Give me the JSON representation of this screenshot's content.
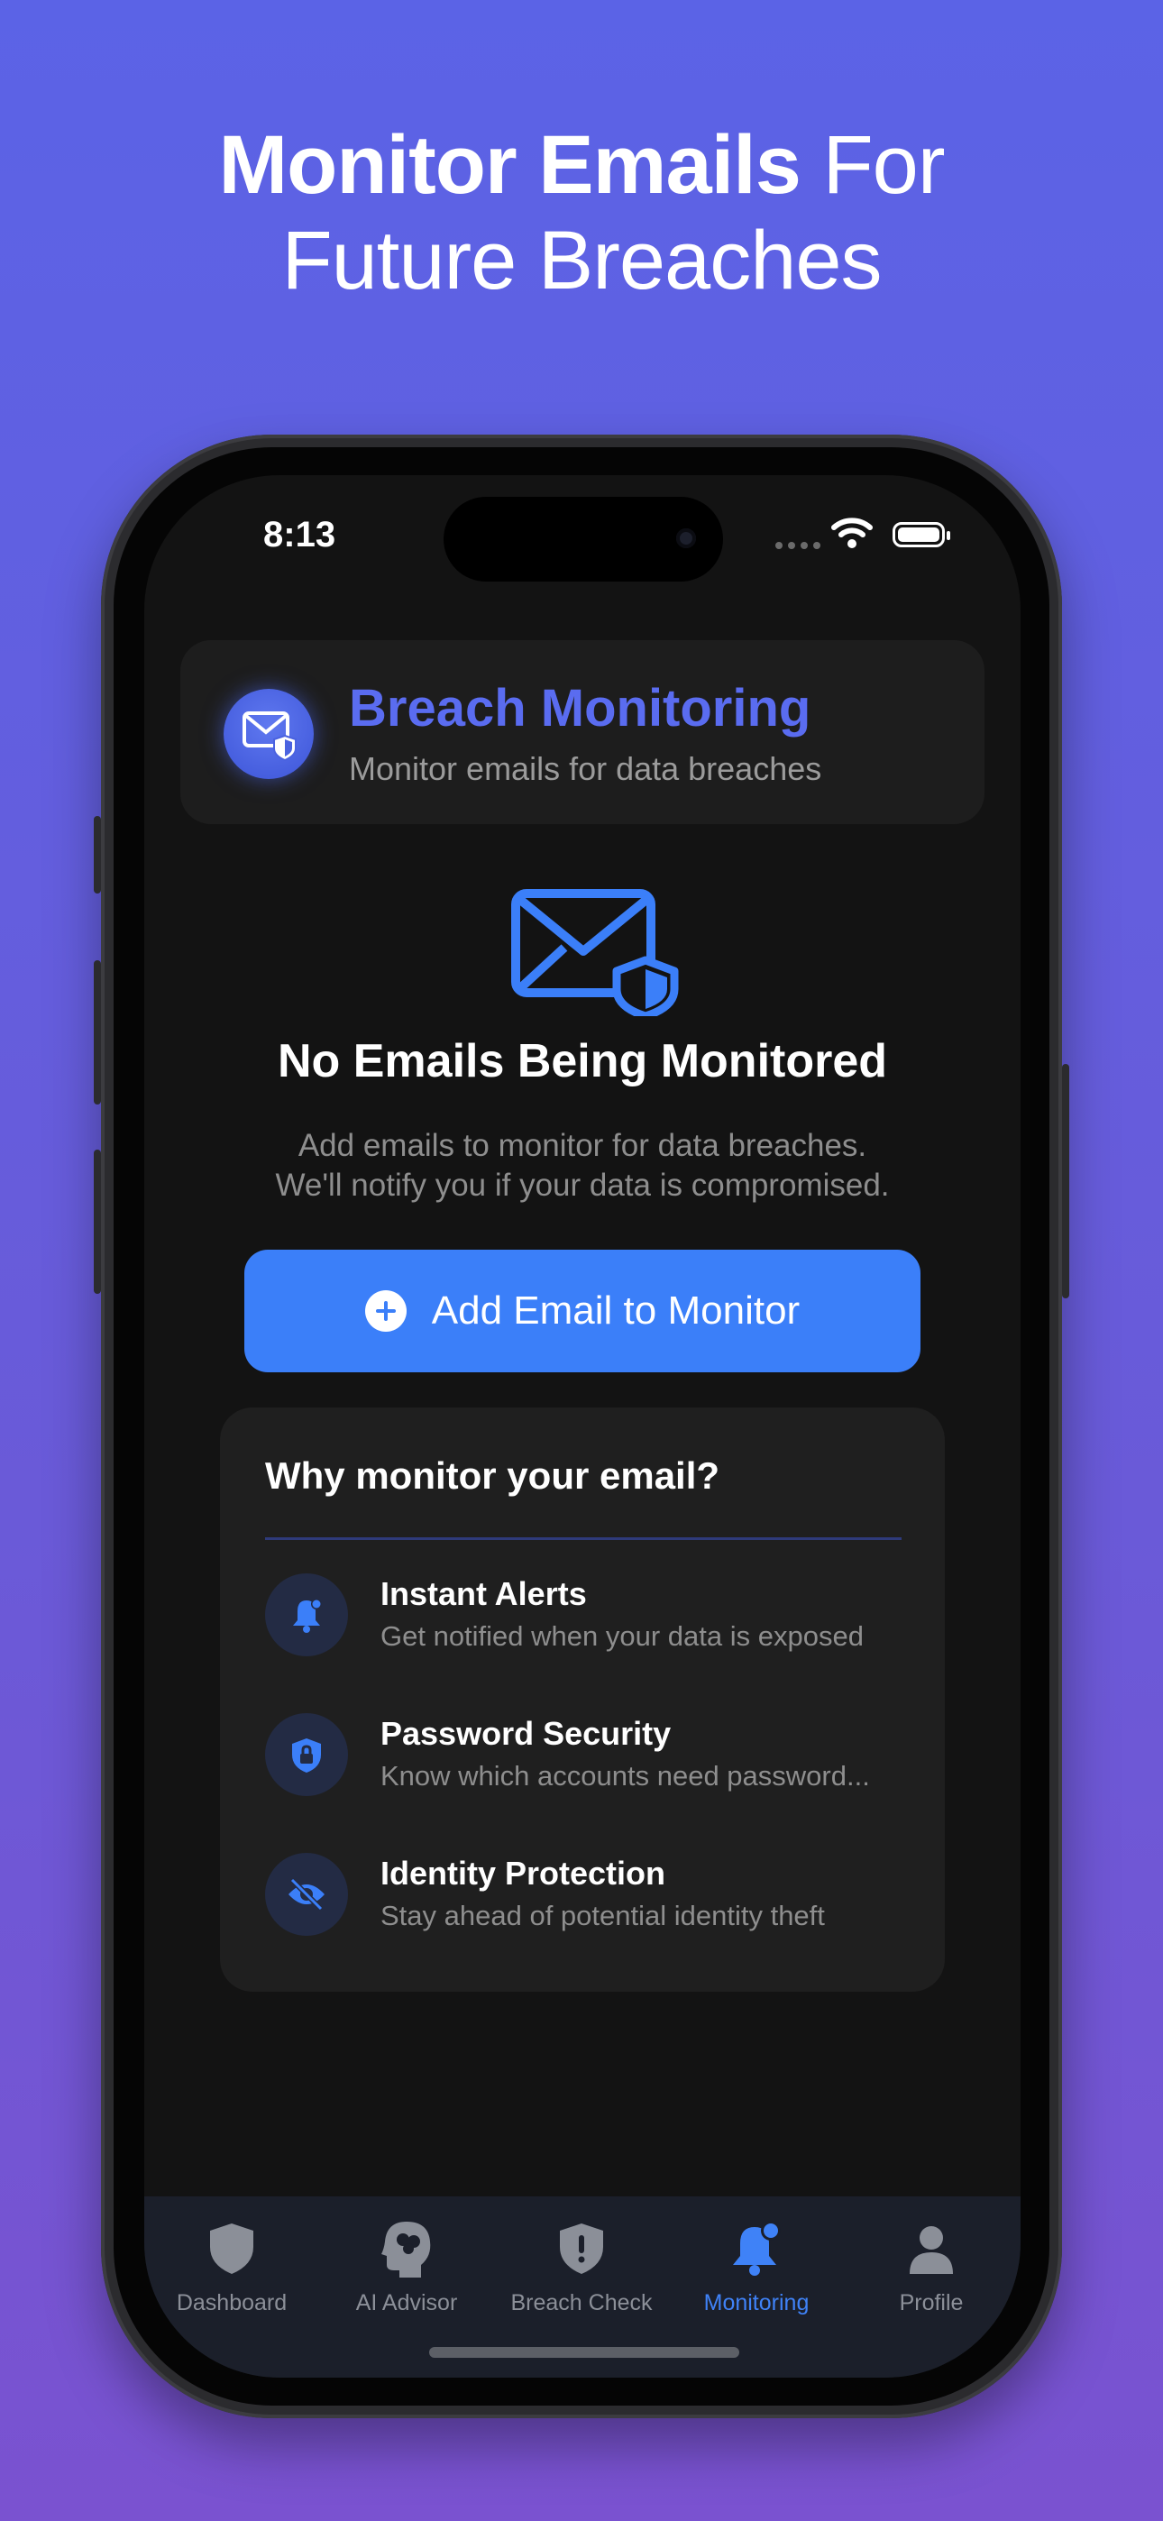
{
  "headline": {
    "bold": "Monitor Emails",
    "regular": " For",
    "line2": "Future Breaches"
  },
  "status_bar": {
    "time": "8:13"
  },
  "header": {
    "title": "Breach Monitoring",
    "subtitle": "Monitor emails for data breaches",
    "icon": "envelope-shield-icon"
  },
  "empty_state": {
    "icon": "envelope-shield-icon",
    "title": "No Emails Being Monitored",
    "description_line1": "Add emails to monitor for data breaches.",
    "description_line2": "We'll notify you if your data is compromised."
  },
  "add_button": {
    "label": "Add Email to Monitor",
    "icon": "plus-circle-icon"
  },
  "why_card": {
    "title": "Why monitor your email?",
    "features": [
      {
        "title": "Instant Alerts",
        "description": "Get notified when your data is exposed",
        "icon": "bell-badge-icon"
      },
      {
        "title": "Password Security",
        "description": "Know which accounts need password...",
        "icon": "lock-shield-icon"
      },
      {
        "title": "Identity Protection",
        "description": "Stay ahead of potential identity theft",
        "icon": "eye-slash-icon"
      }
    ]
  },
  "tabs": [
    {
      "label": "Dashboard",
      "icon": "shield-icon"
    },
    {
      "label": "AI Advisor",
      "icon": "brain-head-icon"
    },
    {
      "label": "Breach Check",
      "icon": "shield-exclamation-icon"
    },
    {
      "label": "Monitoring",
      "icon": "bell-badge-icon",
      "active": true
    },
    {
      "label": "Profile",
      "icon": "person-icon"
    }
  ],
  "colors": {
    "accent": "#3b7ff9",
    "title_accent": "#5a6cf0",
    "active_tab": "#3f82f7",
    "background_top": "#5b63e6",
    "background_bottom": "#7a52d0"
  }
}
